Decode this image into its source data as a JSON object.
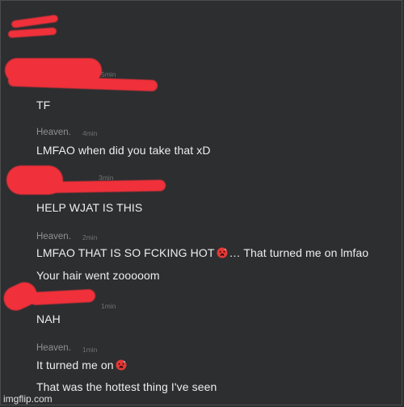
{
  "messages": [
    {
      "time": "5min",
      "text": "TF"
    },
    {
      "author": "Heaven.",
      "time": "4min",
      "text": "LMFAO when did you take that xD"
    },
    {
      "time": "3min",
      "text": "HELP WJAT IS THIS"
    },
    {
      "author": "Heaven.",
      "time": "2min",
      "text_part1": "LMFAO THAT IS SO FCKING HOT",
      "text_part2": "… That turned me on lmfao",
      "text_line2": "Your hair went zooooom",
      "emoji_icon": "hot-face-emoji-icon"
    },
    {
      "time": "1min",
      "text": "NAH"
    },
    {
      "author": "Heaven.",
      "time": "1min",
      "text": "It turned me on",
      "text_line2": "That was the hottest thing I've seen",
      "emoji_icon": "hot-face-emoji-icon"
    }
  ],
  "watermark": "imgflip.com",
  "colors": {
    "background": "#2c2e30",
    "redaction": "#f0303a",
    "message_text": "#eeeeee",
    "author_text": "#8e9092"
  }
}
